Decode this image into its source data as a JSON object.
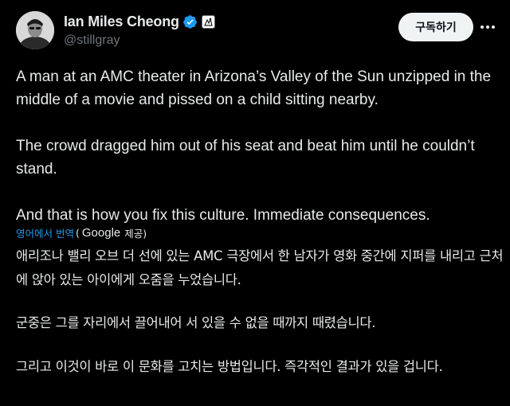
{
  "author": {
    "display_name": "Ian Miles Cheong",
    "handle": "@stillgray"
  },
  "actions": {
    "follow_label": "구독하기"
  },
  "tweet": {
    "paragraphs": [
      "A man at an AMC theater in Arizona’s Valley of the Sun unzipped in the middle of a movie and pissed on a child sitting nearby.",
      "The crowd dragged him out of his seat and beat him until he couldn’t stand.",
      "And that is how you fix this culture. Immediate consequences."
    ]
  },
  "translation": {
    "link_label": "영어에서 번역",
    "open_paren": "(",
    "provider": "Google",
    "suffix": "제공)",
    "paragraphs": [
      "애리조나 밸리 오브 더 선에 있는 AMC 극장에서 한 남자가 영화 중간에 지퍼를 내리고 근처에 앉아 있는 아이에게 오줌을 누었습니다.",
      "군중은 그를 자리에서 끌어내어 서 있을 수 없을 때까지 때렸습니다.",
      "그리고 이것이 바로 이 문화를 고치는 방법입니다. 즉각적인 결과가 있을 겁니다."
    ]
  },
  "colors": {
    "background": "#000000",
    "text": "#e7e9ea",
    "secondary": "#71767b",
    "link": "#1d9bf0",
    "verified": "#1d9bf0"
  },
  "icons": {
    "verified": "verified-badge-icon",
    "affiliate": "affiliate-badge-icon",
    "more": "more-horizontal-icon"
  }
}
